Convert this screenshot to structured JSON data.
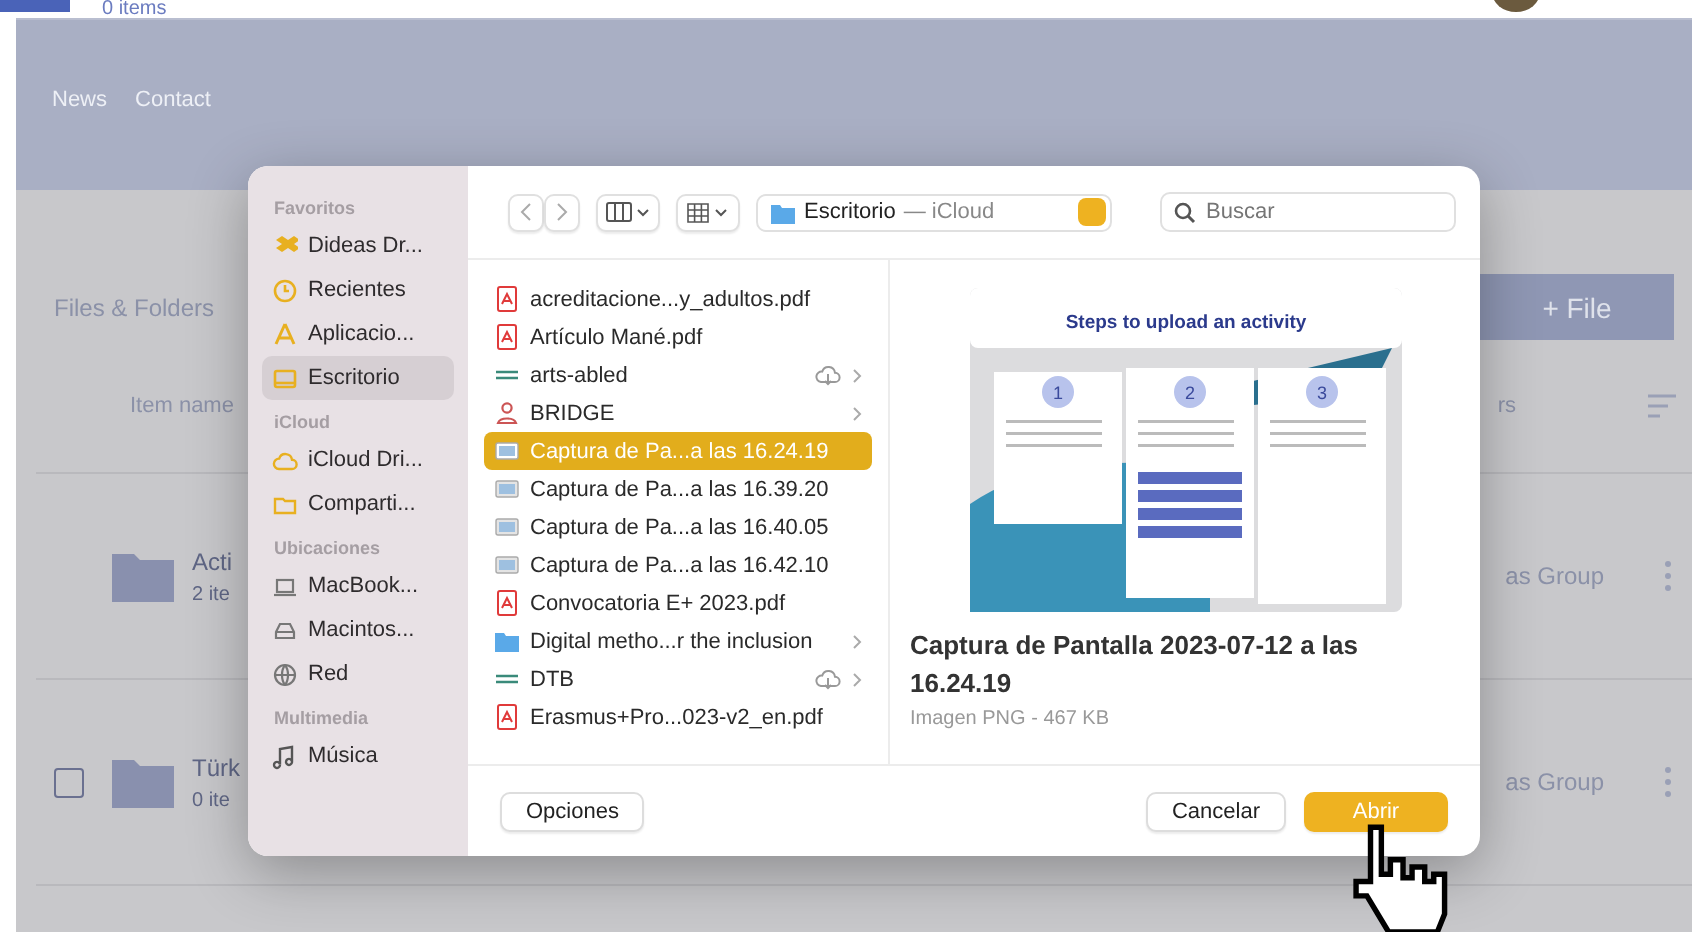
{
  "page": {
    "item_count": "0 items",
    "nav": [
      "News",
      "Contact"
    ],
    "section_title": "Files & Folders",
    "add_button": "+ File",
    "columns": [
      "Item name",
      "rs"
    ],
    "rows": [
      {
        "name": "Acti",
        "count": "2 ite",
        "owner": "as Group",
        "has_checkbox": false
      },
      {
        "name": "Türk",
        "count": "0 ite",
        "owner": "as Group",
        "has_checkbox": true,
        "checked": false
      }
    ]
  },
  "dialog": {
    "sidebar": [
      {
        "heading": "Favoritos",
        "items": [
          {
            "label": "Dideas Dr...",
            "selected": false
          },
          {
            "label": "Recientes",
            "selected": false
          },
          {
            "label": "Aplicacio...",
            "selected": false
          },
          {
            "label": "Escritorio",
            "selected": true
          }
        ]
      },
      {
        "heading": "iCloud",
        "items": [
          {
            "label": "iCloud Dri...",
            "selected": false
          },
          {
            "label": "Comparti...",
            "selected": false
          }
        ]
      },
      {
        "heading": "Ubicaciones",
        "items": [
          {
            "label": "MacBook...",
            "selected": false
          },
          {
            "label": "Macintos...",
            "selected": false
          },
          {
            "label": "Red",
            "selected": false
          }
        ]
      },
      {
        "heading": "Multimedia",
        "items": [
          {
            "label": "Música",
            "selected": false
          }
        ]
      }
    ],
    "location": {
      "folder": "Escritorio",
      "place": "— iCloud"
    },
    "search": {
      "placeholder": "Buscar"
    },
    "files": [
      {
        "name": "acreditacione...y_adultos.pdf",
        "kind": "pdf",
        "cloud": false,
        "expandable": false,
        "selected": false
      },
      {
        "name": "Artículo Mané.pdf",
        "kind": "pdf",
        "cloud": false,
        "expandable": false,
        "selected": false
      },
      {
        "name": "arts-abled",
        "kind": "app",
        "cloud": true,
        "expandable": true,
        "selected": false
      },
      {
        "name": "BRIDGE",
        "kind": "person",
        "cloud": false,
        "expandable": true,
        "selected": false
      },
      {
        "name": "Captura de Pa...a las 16.24.19",
        "kind": "image",
        "cloud": false,
        "expandable": false,
        "selected": true
      },
      {
        "name": "Captura de Pa...a las 16.39.20",
        "kind": "image",
        "cloud": false,
        "expandable": false,
        "selected": false
      },
      {
        "name": "Captura de Pa...a las 16.40.05",
        "kind": "image",
        "cloud": false,
        "expandable": false,
        "selected": false
      },
      {
        "name": "Captura de Pa...a las 16.42.10",
        "kind": "image",
        "cloud": false,
        "expandable": false,
        "selected": false
      },
      {
        "name": "Convocatoria E+ 2023.pdf",
        "kind": "pdf",
        "cloud": false,
        "expandable": false,
        "selected": false
      },
      {
        "name": "Digital metho...r the inclusion",
        "kind": "folder",
        "cloud": false,
        "expandable": true,
        "selected": false
      },
      {
        "name": "DTB",
        "kind": "app",
        "cloud": true,
        "expandable": true,
        "selected": false
      },
      {
        "name": "Erasmus+Pro...023-v2_en.pdf",
        "kind": "pdf",
        "cloud": false,
        "expandable": false,
        "selected": false
      }
    ],
    "preview": {
      "thumb_title": "Steps to upload an activity",
      "steps": [
        "1",
        "2",
        "3"
      ],
      "title": "Captura de Pantalla 2023-07-12 a las 16.24.19",
      "info": "Imagen PNG - 467 KB"
    },
    "buttons": [
      {
        "label": "Opciones",
        "kind": "secondary"
      },
      {
        "label": "Cancelar",
        "kind": "secondary"
      },
      {
        "label": "Abrir",
        "kind": "default"
      }
    ]
  }
}
